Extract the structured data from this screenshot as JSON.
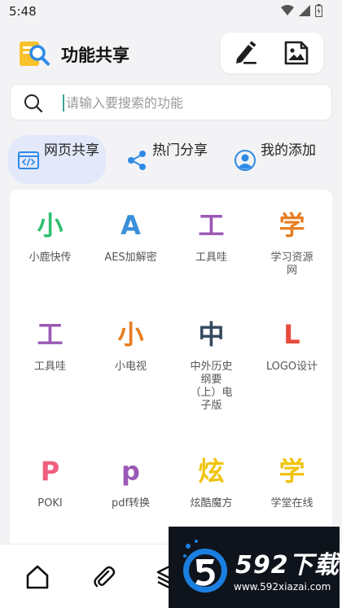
{
  "status_bar": {
    "time": "5:48"
  },
  "header": {
    "title": "功能共享"
  },
  "search": {
    "placeholder": "请输入要搜索的功能",
    "value": ""
  },
  "tabs": [
    {
      "label": "网页共享",
      "icon": "code-window-icon",
      "active": true
    },
    {
      "label": "热门分享",
      "icon": "share-icon",
      "active": false
    },
    {
      "label": "我的添加",
      "icon": "user-icon",
      "active": false
    }
  ],
  "grid": [
    {
      "glyph": "小",
      "label": "小鹿快传",
      "color": "#2fbf71"
    },
    {
      "glyph": "A",
      "label": "AES加解密",
      "color": "#3a8fd8"
    },
    {
      "glyph": "工",
      "label": "工具哇",
      "color": "#9b59b6"
    },
    {
      "glyph": "学",
      "label": "学习资源网",
      "color": "#e67e22"
    },
    {
      "glyph": "工",
      "label": "工具哇",
      "color": "#9b59b6"
    },
    {
      "glyph": "小",
      "label": "小电视",
      "color": "#e67e22"
    },
    {
      "glyph": "中",
      "label": "中外历史纲要（上）电子版",
      "color": "#34495e"
    },
    {
      "glyph": "L",
      "label": "LOGO设计",
      "color": "#e74c3c"
    },
    {
      "glyph": "P",
      "label": "POKI",
      "color": "#f06080"
    },
    {
      "glyph": "p",
      "label": "pdf转换",
      "color": "#9b59b6"
    },
    {
      "glyph": "炫",
      "label": "炫酷魔方",
      "color": "#f1c40f"
    },
    {
      "glyph": "学",
      "label": "学堂在线",
      "color": "#f1c40f"
    }
  ],
  "bottom_nav": [
    {
      "icon": "home-icon"
    },
    {
      "icon": "attachment-icon"
    },
    {
      "icon": "layers-icon"
    }
  ],
  "watermark": {
    "brand": "592下载",
    "url": "www.592xiazai.com"
  }
}
